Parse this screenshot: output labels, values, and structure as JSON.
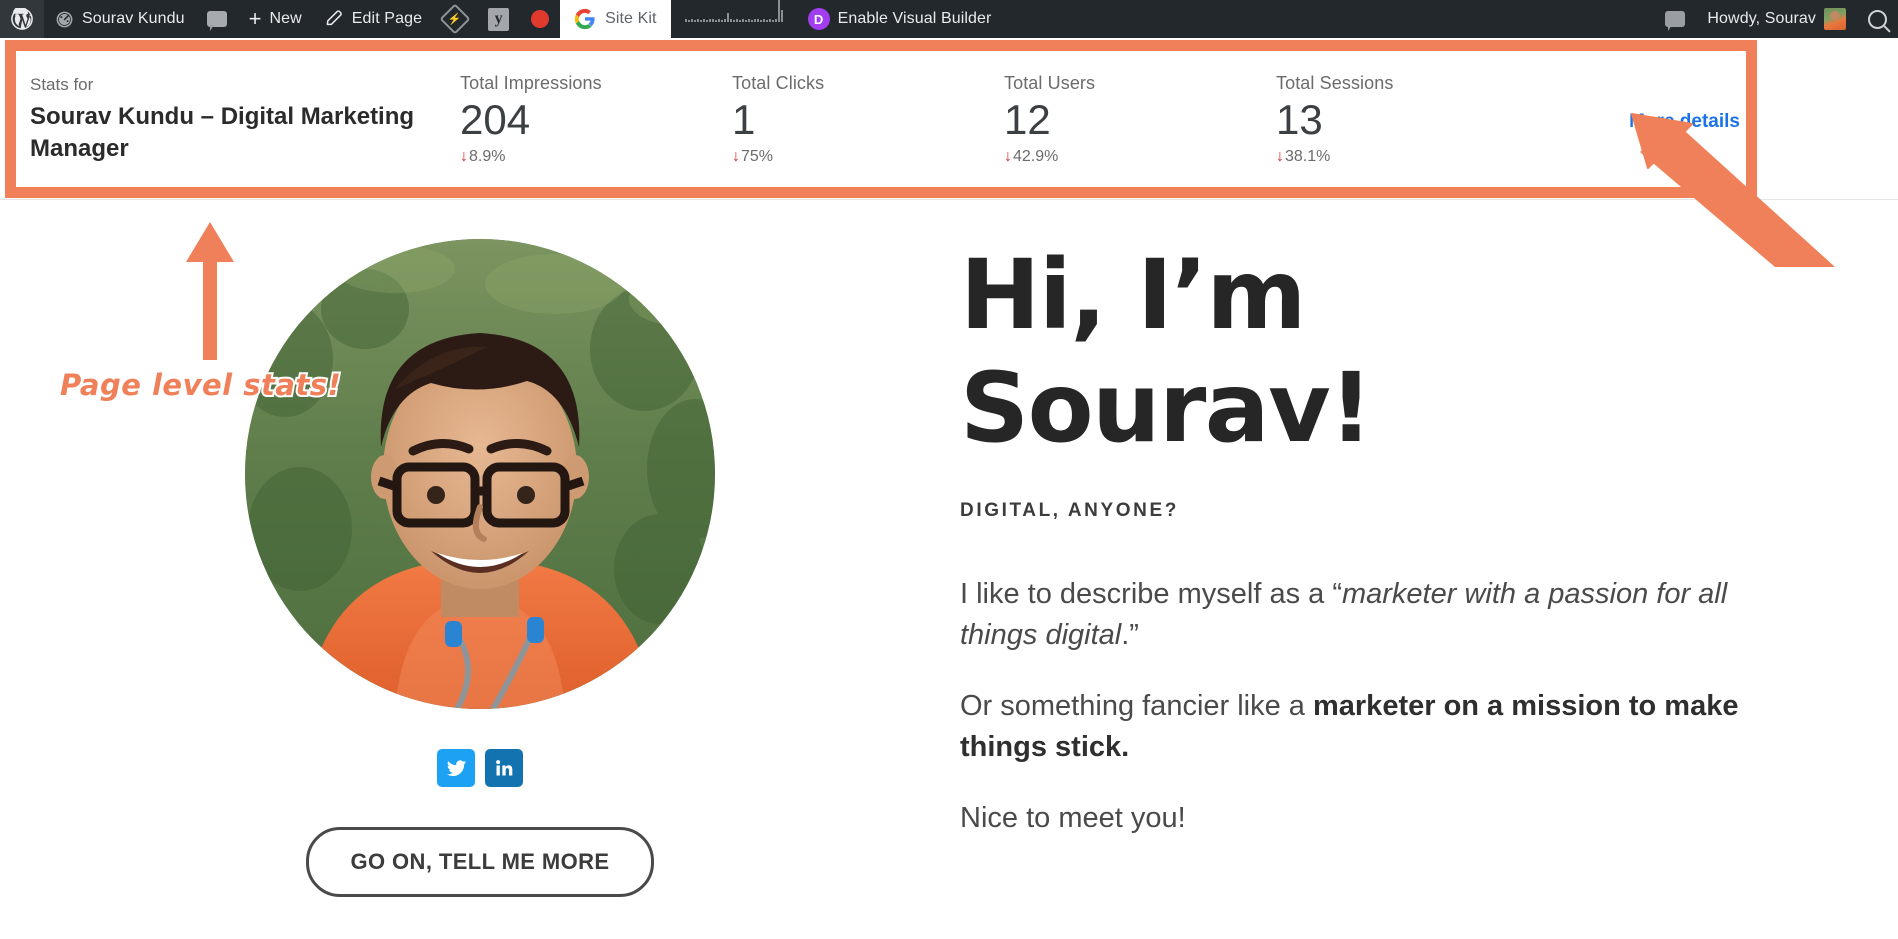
{
  "admin_bar": {
    "wp_logo_icon": "wordpress-logo-icon",
    "items": [
      {
        "icon": "dashboard-speedometer-icon",
        "label": "Sourav Kundu",
        "name": "admin-bar-site-name"
      },
      {
        "icon": "comment-bubble-icon",
        "label": "",
        "name": "admin-bar-comments"
      },
      {
        "icon": "plus-icon",
        "label": "New",
        "name": "admin-bar-new-content"
      },
      {
        "icon": "pencil-icon",
        "label": "Edit Page",
        "name": "admin-bar-edit-page"
      },
      {
        "icon": "jetpack-diamond-icon",
        "label": "",
        "name": "admin-bar-jetpack"
      },
      {
        "icon": "yoast-seo-icon",
        "label": "",
        "name": "admin-bar-yoast"
      },
      {
        "icon": "red-dot-icon",
        "label": "",
        "name": "admin-bar-red-dot"
      }
    ],
    "site_kit": {
      "label": "Site Kit",
      "icon": "google-g-icon",
      "name": "admin-bar-site-kit"
    },
    "sparkline_values": [
      3,
      2,
      3,
      2,
      3,
      2,
      3,
      2,
      3,
      3,
      2,
      3,
      2,
      3,
      9,
      3,
      2,
      3,
      2,
      3,
      2,
      3,
      2,
      3,
      3,
      2,
      3,
      2,
      3,
      2,
      3,
      22,
      12
    ],
    "divi": {
      "label": "Enable Visual Builder",
      "icon": "divi-d-icon",
      "name": "admin-bar-divi"
    },
    "right": {
      "notifications_icon": "comment-bubble-icon",
      "howdy": "Howdy, Sourav",
      "avatar_icon": "user-avatar",
      "search_icon": "search-icon"
    }
  },
  "site_kit_stats": {
    "stats_for_label": "Stats for",
    "page_title": "Sourav Kundu – Digital Marketing Manager",
    "metrics": [
      {
        "label": "Total Impressions",
        "value": "204",
        "change": "8.9%",
        "direction": "down"
      },
      {
        "label": "Total Clicks",
        "value": "1",
        "change": "75%",
        "direction": "down"
      },
      {
        "label": "Total Users",
        "value": "12",
        "change": "42.9%",
        "direction": "down"
      },
      {
        "label": "Total Sessions",
        "value": "13",
        "change": "38.1%",
        "direction": "down"
      }
    ],
    "more_details_label": "More details",
    "down_arrow_glyph": "↓",
    "accent_link_color": "#1a73e8",
    "negative_color": "#d93025"
  },
  "annotations": {
    "highlight_color": "#f0805a",
    "page_stats_note": "Page level stats!",
    "arrow_up_name": "annotation-arrow-up",
    "arrow_to_more_details_name": "annotation-arrow-more-details"
  },
  "hero": {
    "photo_alt": "profile-photo-sourav",
    "socials": [
      {
        "name": "twitter",
        "glyph": "twitter-bird-icon"
      },
      {
        "name": "linkedin",
        "glyph": "linkedin-in-icon"
      }
    ],
    "cta_label": "GO ON, TELL ME MORE",
    "heading_line1": "Hi, I’m",
    "heading_line2": "Sourav!",
    "eyebrow": "DIGITAL, ANYONE?",
    "paragraphs": {
      "p1_before": "I like to describe myself as a “",
      "p1_em": "marketer with a passion for all things digital",
      "p1_after": ".”",
      "p2_before": "Or something fancier like a ",
      "p2_bold": "marketer on a mission to make things stick.",
      "p3": "Nice to meet you!"
    }
  }
}
